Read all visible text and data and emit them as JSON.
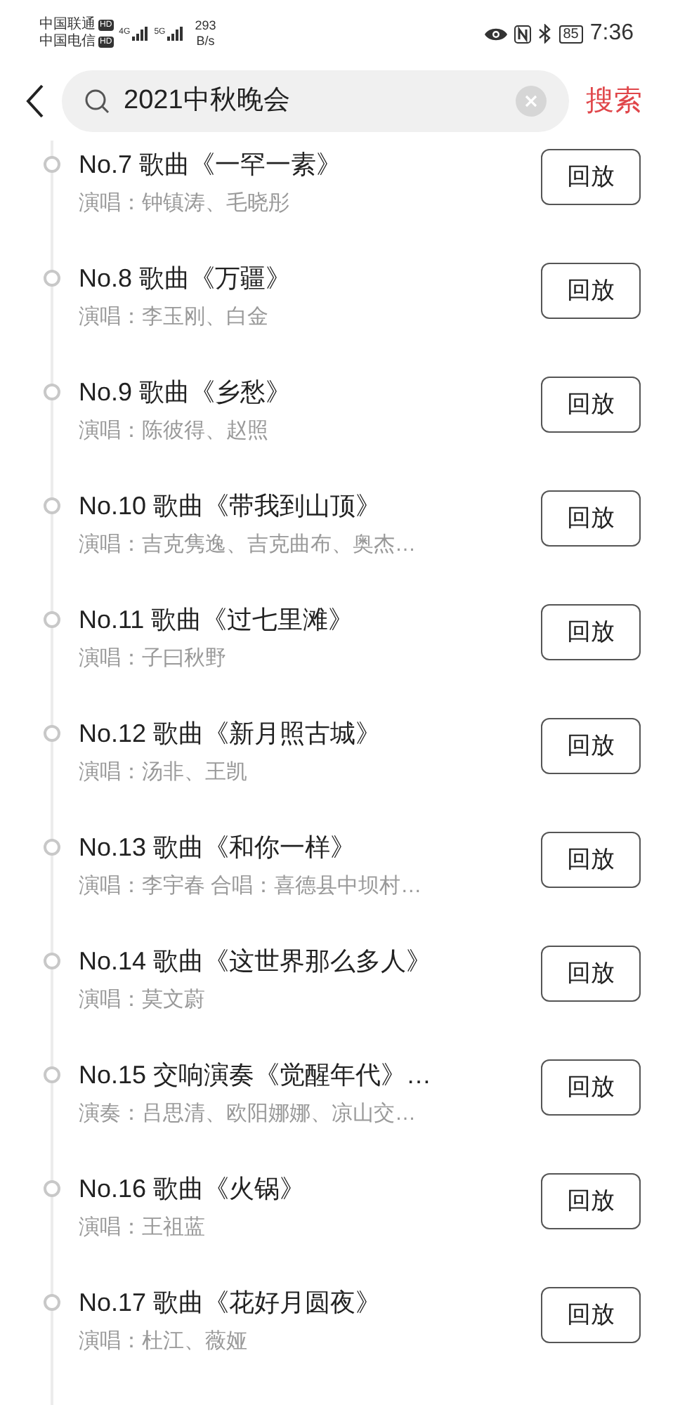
{
  "status_bar": {
    "carriers": [
      {
        "name": "中国联通",
        "badge": "HD"
      },
      {
        "name": "中国电信",
        "badge": "HD"
      }
    ],
    "signals": [
      {
        "label": "4G"
      },
      {
        "label": "5G"
      }
    ],
    "speed": {
      "value": "293",
      "unit": "B/s"
    },
    "battery": "85",
    "time": "7:36"
  },
  "search": {
    "value": "2021中秋晚会",
    "button": "搜索"
  },
  "programs": [
    {
      "title": "No.7 歌曲《一罕一素》",
      "performers": "演唱：钟镇涛、毛晓彤",
      "button": "回放"
    },
    {
      "title": "No.8 歌曲《万疆》",
      "performers": "演唱：李玉刚、白金",
      "button": "回放"
    },
    {
      "title": "No.9 歌曲《乡愁》",
      "performers": "演唱：陈彼得、赵照",
      "button": "回放"
    },
    {
      "title": "No.10 歌曲《带我到山顶》",
      "performers": "演唱：吉克隽逸、吉克曲布、奥杰…",
      "button": "回放"
    },
    {
      "title": "No.11 歌曲《过七里滩》",
      "performers": "演唱：子曰秋野",
      "button": "回放"
    },
    {
      "title": "No.12 歌曲《新月照古城》",
      "performers": "演唱：汤非、王凯",
      "button": "回放"
    },
    {
      "title": "No.13 歌曲《和你一样》",
      "performers": "演唱：李宇春 合唱：喜德县中坝村…",
      "button": "回放"
    },
    {
      "title": "No.14 歌曲《这世界那么多人》",
      "performers": "演唱：莫文蔚",
      "button": "回放"
    },
    {
      "title": "No.15 交响演奏《觉醒年代》…",
      "performers": "演奏：吕思清、欧阳娜娜、凉山交…",
      "button": "回放"
    },
    {
      "title": "No.16 歌曲《火锅》",
      "performers": "演唱：王祖蓝",
      "button": "回放"
    },
    {
      "title": "No.17 歌曲《花好月圆夜》",
      "performers": "演唱：杜江、薇娅",
      "button": "回放"
    }
  ]
}
